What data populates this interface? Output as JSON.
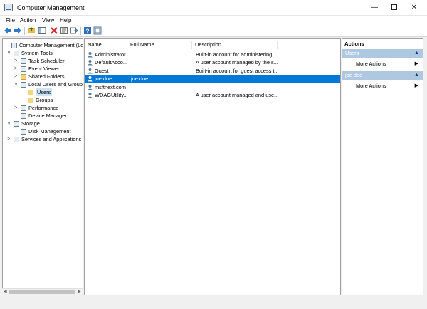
{
  "window": {
    "title": "Computer Management",
    "minimize": "—",
    "close": "✕"
  },
  "menu": [
    "File",
    "Action",
    "View",
    "Help"
  ],
  "tree": [
    {
      "label": "Computer Management (Local",
      "indent": 0,
      "expander": "",
      "icon": "computer"
    },
    {
      "label": "System Tools",
      "indent": 1,
      "expander": "∨",
      "icon": "tools"
    },
    {
      "label": "Task Scheduler",
      "indent": 2,
      "expander": ">",
      "icon": "scheduler"
    },
    {
      "label": "Event Viewer",
      "indent": 2,
      "expander": ">",
      "icon": "event-viewer"
    },
    {
      "label": "Shared Folders",
      "indent": 2,
      "expander": ">",
      "icon": "folder"
    },
    {
      "label": "Local Users and Groups",
      "indent": 2,
      "expander": "∨",
      "icon": "users"
    },
    {
      "label": "Users",
      "indent": 3,
      "expander": "",
      "icon": "folder",
      "selected": true
    },
    {
      "label": "Groups",
      "indent": 3,
      "expander": "",
      "icon": "folder"
    },
    {
      "label": "Performance",
      "indent": 2,
      "expander": ">",
      "icon": "performance"
    },
    {
      "label": "Device Manager",
      "indent": 2,
      "expander": "",
      "icon": "device-manager"
    },
    {
      "label": "Storage",
      "indent": 1,
      "expander": "∨",
      "icon": "storage"
    },
    {
      "label": "Disk Management",
      "indent": 2,
      "expander": "",
      "icon": "disk"
    },
    {
      "label": "Services and Applications",
      "indent": 1,
      "expander": ">",
      "icon": "services"
    }
  ],
  "list": {
    "columns": [
      "Name",
      "Full Name",
      "Description"
    ],
    "rows": [
      {
        "name": "Administrator",
        "full_name": "",
        "description": "Built-in account for administering..."
      },
      {
        "name": "DefaultAcco...",
        "full_name": "",
        "description": "A user account managed by the s..."
      },
      {
        "name": "Guest",
        "full_name": "",
        "description": "Built-in account for guest access t..."
      },
      {
        "name": "joe doe",
        "full_name": "joe doe",
        "description": "",
        "selected": true
      },
      {
        "name": "msftnext.com",
        "full_name": "",
        "description": ""
      },
      {
        "name": "WDAGUtility...",
        "full_name": "",
        "description": "A user account managed and use..."
      }
    ]
  },
  "actions": {
    "header": "Actions",
    "sections": [
      {
        "title": "Users",
        "items": [
          "More Actions"
        ]
      },
      {
        "title": "joe doe",
        "items": [
          "More Actions"
        ]
      }
    ]
  },
  "toolbar": [
    "back-arrow-icon",
    "forward-arrow-icon",
    "up-folder-icon",
    "show-hide-tree-icon",
    "delete-icon",
    "properties-icon",
    "export-list-icon",
    "help-icon",
    "mmc-view-icon"
  ],
  "colors": {
    "selection": "#0078d7",
    "action_section": "#aec8e2",
    "tree_selection": "#cce4f7"
  }
}
